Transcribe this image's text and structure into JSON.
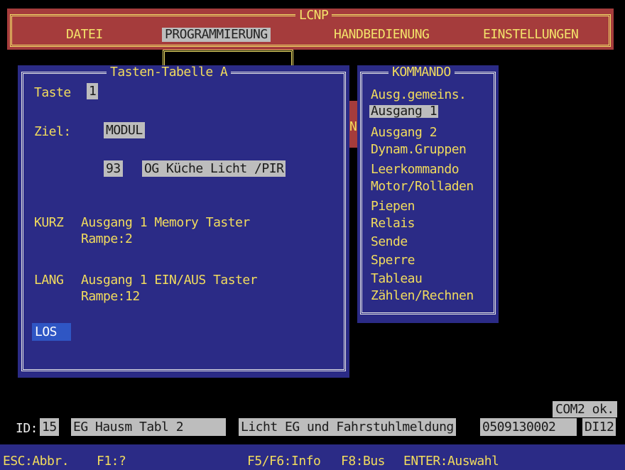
{
  "menu": {
    "title": "LCNP",
    "items": [
      "DATEI",
      "PROGRAMMIERUNG",
      "HANDBEDIENUNG",
      "EINSTELLUNGEN"
    ]
  },
  "tasten": {
    "title": "Tasten-Tabelle A",
    "taste_label": "Taste",
    "taste_value": "1",
    "ziel_label": "Ziel:",
    "ziel_value": "MODUL",
    "module_number": "93",
    "module_name": "OG Küche Licht /PIR",
    "kurz_label": "KURZ",
    "kurz_action": "Ausgang 1 Memory Taster",
    "kurz_rampe": "Rampe:2",
    "lang_label": "LANG",
    "lang_action": "Ausgang 1 EIN/AUS Taster",
    "lang_rampe": "Rampe:12",
    "los": "LOS"
  },
  "kommando": {
    "title": "KOMMANDO",
    "items": [
      "Ausg.gemeins.",
      "Ausgang 1",
      "Ausgang 2",
      "Dynam.Gruppen",
      "Leerkommando",
      "Motor/Rolladen",
      "Piepen",
      "Relais",
      "Sende",
      "Sperre",
      "Tableau",
      "Zählen/Rechnen"
    ],
    "partial_letter": "N"
  },
  "status": {
    "com": "COM2 ok.",
    "id_label": "ID:",
    "id_value": "15",
    "device": "EG Hausm Tabl 2",
    "description": "Licht EG und Fahrstuhlmeldung",
    "serial": "0509130002",
    "code": "DI12"
  },
  "help": {
    "esc": "ESC:Abbr.",
    "f1": "F1:?",
    "f5f6": "F5/F6:Info",
    "f8": "F8:Bus",
    "enter": "ENTER:Auswahl"
  },
  "colors": {
    "background": "#000000",
    "menu_red": "#a53c3c",
    "panel_blue": "#2b2b86",
    "text_yellow": "#f2dc5d",
    "highlight_gray": "#bdbdbd",
    "input_blue": "#2f56c4"
  }
}
